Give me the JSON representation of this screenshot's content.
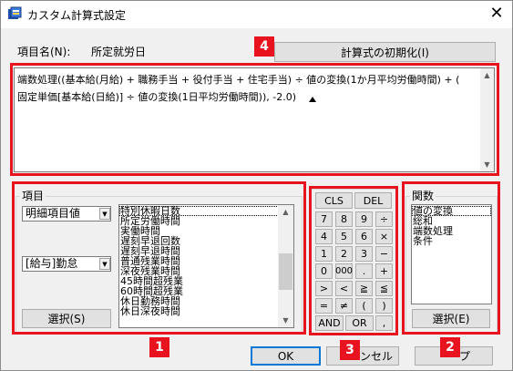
{
  "window": {
    "title": "カスタム計算式設定",
    "close_glyph": "✕"
  },
  "item_name": {
    "label": "項目名(N):",
    "value": "所定就労日"
  },
  "init_button": "計算式の初期化(I)",
  "formula": {
    "line1": "端数処理((基本給(月給) + 職務手当 + 役付手当 + 住宅手当) ÷ 値の変換(1か月平均労働時間) + (",
    "line2": "固定単価[基本給(日給)] ÷ 値の変換(1日平均労働時間)), -2.0)"
  },
  "items_group": {
    "title": "項目",
    "combo1": "明細項目値",
    "combo2": "[給与]勤怠",
    "select_button": "選択(S)",
    "list": [
      "特別休暇日数",
      "所定労働時間",
      "実働時間",
      "遅刻早退回数",
      "遅刻早退時間",
      "普通残業時間",
      "深夜残業時間",
      "45時間超残業",
      "60時間超残業",
      "休日勤務時間",
      "休日深夜時間"
    ]
  },
  "keypad": {
    "cls": "CLS",
    "del": "DEL",
    "rows": [
      [
        "7",
        "8",
        "9",
        "÷"
      ],
      [
        "4",
        "5",
        "6",
        "×"
      ],
      [
        "1",
        "2",
        "3",
        "−"
      ],
      [
        "0",
        "000",
        ".",
        "+"
      ],
      [
        ">",
        "<",
        "≧",
        "≦"
      ],
      [
        "=",
        "≠",
        "(",
        ")"
      ]
    ],
    "and": "AND",
    "or": "OR",
    "comma": ","
  },
  "functions_group": {
    "title": "関数",
    "list": [
      "値の変換",
      "総和",
      "端数処理",
      "条件"
    ],
    "select_button": "選択(E)"
  },
  "footer": {
    "ok": "OK",
    "cancel_partial": "ンセル",
    "apply_partial": "プ"
  },
  "badges": {
    "items": "1",
    "functions": "2",
    "keypad": "3",
    "formula": "4"
  },
  "colors": {
    "annotation": "#e8131e",
    "focus": "#0078d7"
  }
}
